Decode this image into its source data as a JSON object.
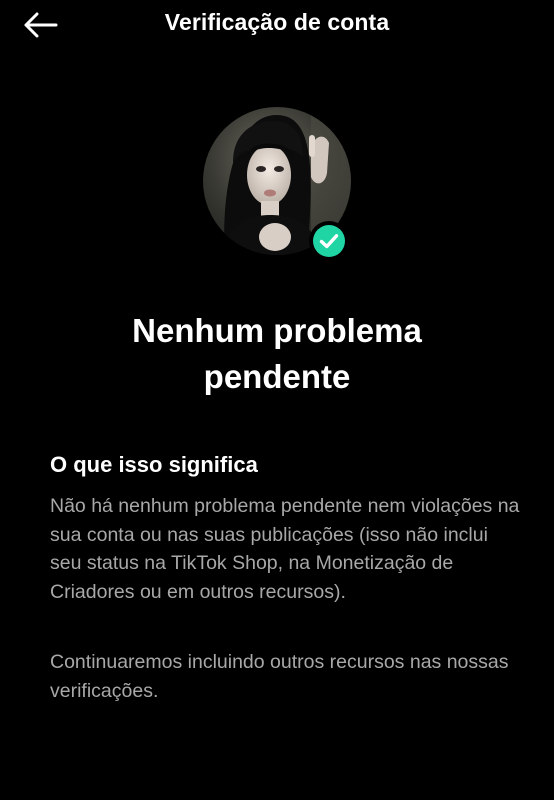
{
  "header": {
    "title": "Verificação de conta",
    "back_icon": "arrow-left-icon"
  },
  "profile": {
    "avatar_icon": "profile-photo",
    "badge_icon": "check-circle-icon",
    "badge_color": "#20D5A4"
  },
  "status": {
    "title_line1": "Nenhum problema",
    "title_line2": "pendente"
  },
  "info": {
    "heading": "O que isso significa",
    "paragraph1": "Não há nenhum problema pendente nem violações na sua conta ou nas suas publicações (isso não inclui seu status na TikTok Shop, na Monetização de Criadores ou em outros recursos).",
    "paragraph2": "Continuaremos incluindo outros recursos nas nossas verificações."
  }
}
